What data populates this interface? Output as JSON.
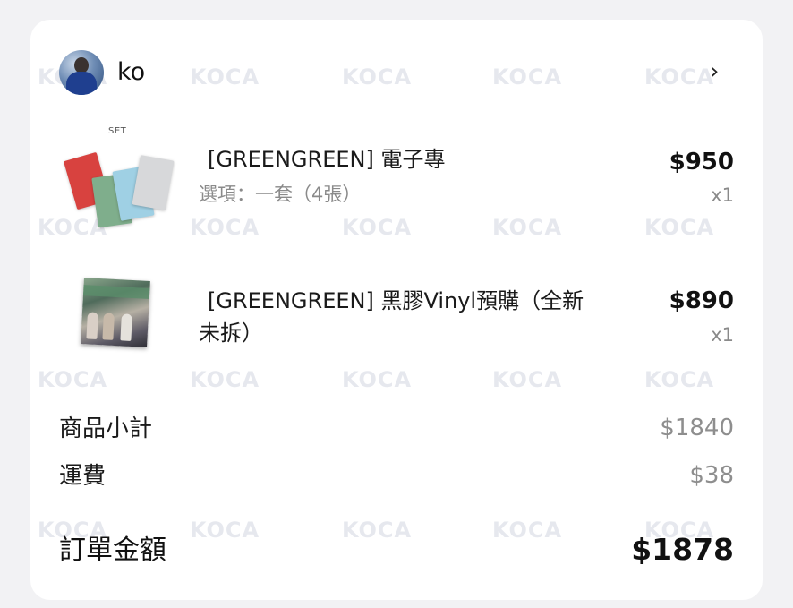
{
  "shop": {
    "name": "ko",
    "avatar_icon": "avatar-photo",
    "chevron": "›"
  },
  "items": [
    {
      "badge": "SET",
      "title": "[GREENGREEN] 電子專",
      "option": "選項：一套（4張）",
      "price": "$950",
      "qty": "x1"
    },
    {
      "title_line1": "[GREENGREEN] 黑膠Vinyl預購（全新",
      "title_line2": "未拆）",
      "price": "$890",
      "qty": "x1"
    }
  ],
  "summary": {
    "subtotal_label": "商品小計",
    "subtotal_value": "$1840",
    "shipping_label": "運費",
    "shipping_value": "$38",
    "total_label": "訂單金額",
    "total_value": "$1878"
  },
  "watermark": "KOCA",
  "colors": {
    "accent_text": "#111111",
    "muted_text": "#8a8a8a",
    "card_bg": "#ffffff",
    "page_bg": "#f2f2f4"
  }
}
